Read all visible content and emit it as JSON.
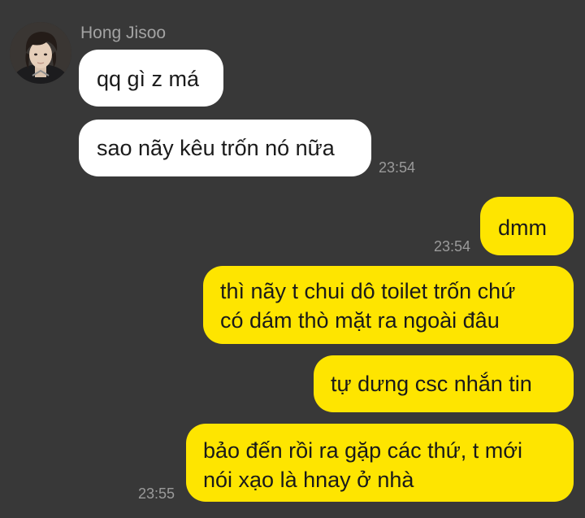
{
  "chat": {
    "sender_name": "Hong Jisoo",
    "colors": {
      "background": "#383838",
      "incoming_bubble": "#ffffff",
      "outgoing_bubble": "#fee500",
      "timestamp": "#9a9a9a",
      "sender_name": "#a3a3a3"
    },
    "messages": [
      {
        "direction": "incoming",
        "lines": [
          "qq gì z má"
        ]
      },
      {
        "direction": "incoming",
        "lines": [
          "sao nãy kêu trốn nó nữa"
        ],
        "time": "23:54"
      },
      {
        "direction": "outgoing",
        "lines": [
          "dmm"
        ],
        "time": "23:54"
      },
      {
        "direction": "outgoing",
        "lines": [
          "thì nãy t chui dô toilet trốn chứ",
          "có dám thò mặt ra ngoài đâu"
        ]
      },
      {
        "direction": "outgoing",
        "lines": [
          "tự dưng csc nhắn tin"
        ]
      },
      {
        "direction": "outgoing",
        "lines": [
          "bảo đến rồi ra gặp các thứ, t mới",
          "nói xạo là hnay ở nhà"
        ],
        "time": "23:55"
      }
    ]
  }
}
